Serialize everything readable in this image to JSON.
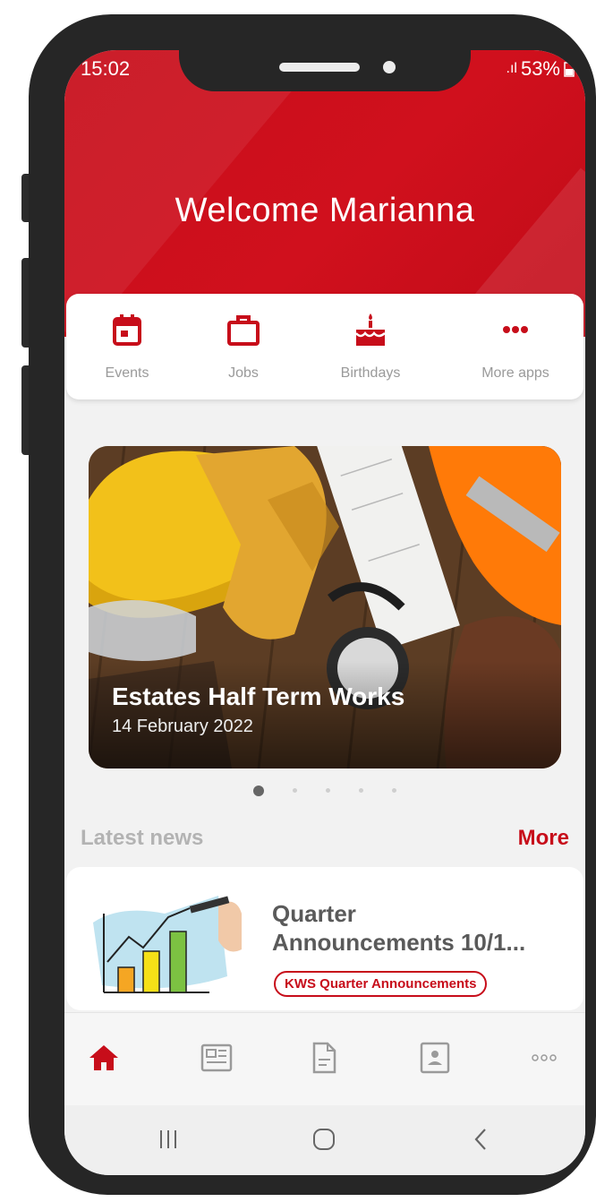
{
  "status": {
    "time": "15:02",
    "battery": "53%"
  },
  "header": {
    "welcome": "Welcome Marianna",
    "brand_color": "#c70d1a"
  },
  "apps": [
    {
      "label": "Events",
      "icon": "calendar-icon"
    },
    {
      "label": "Jobs",
      "icon": "briefcase-icon"
    },
    {
      "label": "Birthdays",
      "icon": "cake-icon"
    },
    {
      "label": "More apps",
      "icon": "more-dots-icon"
    }
  ],
  "banner": {
    "title": "Estates Half Term Works",
    "date": "14 February 2022",
    "image": "construction-safety-gear-photo"
  },
  "carousel": {
    "count": 5,
    "active": 1
  },
  "news": {
    "heading": "Latest news",
    "more": "More",
    "items": [
      {
        "title_line1": "Quarter",
        "title_line2": "Announcements 10/1...",
        "tag": "KWS Quarter Announcements",
        "image": "growth-chart-icon"
      }
    ]
  },
  "bottom_nav": [
    "home-icon",
    "news-icon",
    "document-icon",
    "contact-card-icon",
    "more-dots-icon"
  ],
  "system_nav": [
    "recent-apps-icon",
    "home-button-icon",
    "back-icon"
  ]
}
